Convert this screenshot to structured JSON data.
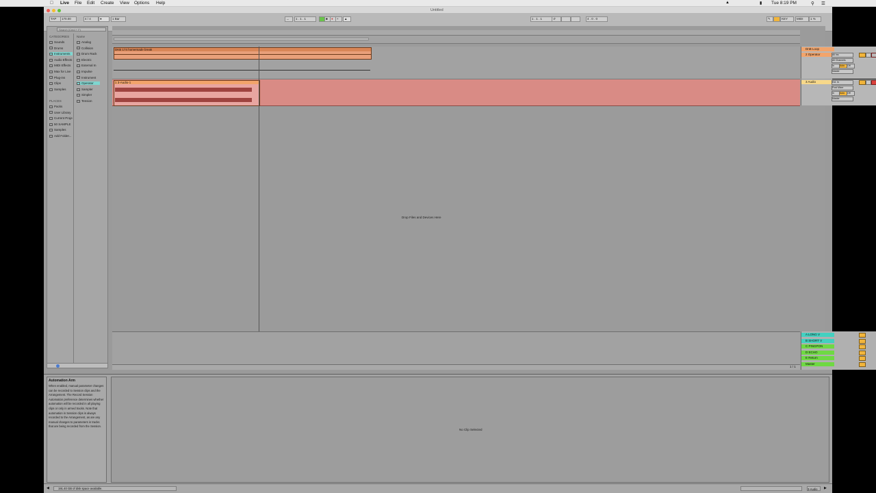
{
  "menubar": {
    "apple_icon": "apple-icon",
    "items": [
      "Live",
      "File",
      "Edit",
      "Create",
      "View",
      "Options",
      "Help"
    ],
    "clock": "Tue 8:19 PM"
  },
  "window": {
    "title": "Untitled"
  },
  "transport": {
    "tap": "TAP",
    "tempo": "170.00",
    "time_sig": "4 / 4",
    "quantize": "1 Bar",
    "position": "1 . 1 . 1",
    "loop_start": "1 . 1 . 1",
    "loop_length": "4 . 0 . 0",
    "key": "KEY",
    "midi": "MIDI",
    "cpu": "1 %"
  },
  "browser": {
    "search_placeholder": "Search (Cmd + F)",
    "categories_header": "CATEGORIES",
    "categories": [
      "Sounds",
      "Drums",
      "Instruments",
      "Audio Effects",
      "MIDI Effects",
      "Max for Live",
      "Plug-ins",
      "Clips",
      "Samples"
    ],
    "selected_category": "Instruments",
    "places_header": "PLACES",
    "places": [
      "Packs",
      "User Library",
      "Current Proje",
      "50 SAMPLE",
      "Samples",
      "Add Folder..."
    ],
    "name_header": "Name",
    "names": [
      "Analog",
      "Collision",
      "Drum Rack",
      "Electric",
      "External In",
      "Impulse",
      "Instrument",
      "Operator",
      "Sampler",
      "Simpler",
      "Tension"
    ],
    "selected_name": "Operator"
  },
  "arrangement": {
    "clips": {
      "midi_clip_title": "DKB 174 homemade break",
      "audio_clip_title": "1 3-Audio-1"
    },
    "drop_text": "Drop Files and Devices Here",
    "tracks": [
      {
        "name": "DnB Loop",
        "color": "#f2a46b"
      },
      {
        "name": "2 Operator",
        "color": "#f2a46b"
      },
      {
        "name": "3 Audio",
        "color": "#f7d88a"
      }
    ],
    "returns": [
      {
        "name": "A LONG V",
        "color": "#43d0c0"
      },
      {
        "name": "B SHORT V",
        "color": "#43d0c0"
      },
      {
        "name": "C PINGPON",
        "color": "#6fd943"
      },
      {
        "name": "D ECHO",
        "color": "#6fd943"
      },
      {
        "name": "E Return",
        "color": "#6fd943"
      },
      {
        "name": "Master",
        "color": "#6fd943"
      }
    ],
    "scroll_readout": "1 / 1"
  },
  "io": {
    "midi_from": "All Ins",
    "midi_channel": "All Channels",
    "monitor_in": "In",
    "monitor_auto": "Auto",
    "monitor_off": "Off",
    "audio_to": "Master",
    "audio_from": "Ext. In",
    "post_mixer": "Post Mixer"
  },
  "detail": {
    "info_title": "Automation Arm",
    "info_body": "When enabled, manual parameter changes can be recorded to Session clips and the Arrangement. The Record Session Automation preference determines whether automation will be recorded in all playing clips or only in armed tracks. Note that automation in Session clips is always recorded to the Arrangement, as are any manual changes to parameters in tracks that are being recorded from the Session.",
    "no_clip": "No Clip Selected"
  },
  "status": {
    "text": "191.40 GB of disk space available.",
    "right": "3-Audio"
  },
  "colors": {
    "audio_lane": "#d98b85",
    "midi_clip": "#e8a07a",
    "selected_browser": "#7fd6d0",
    "arm_red": "#d9413b",
    "active_yellow": "#f2b53b"
  }
}
